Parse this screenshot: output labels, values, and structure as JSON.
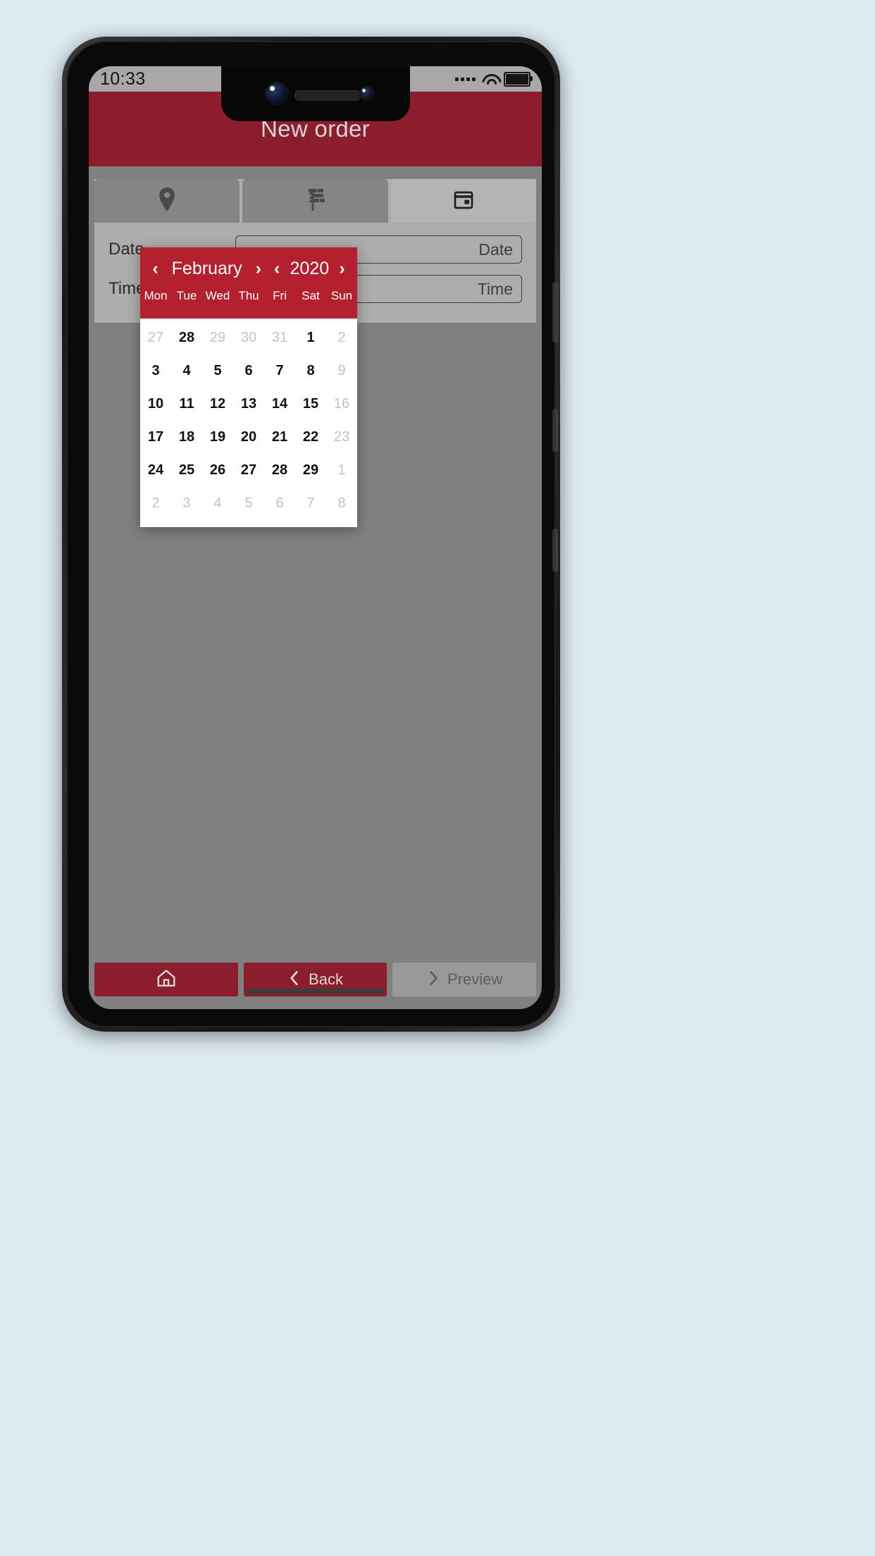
{
  "status_bar": {
    "time": "10:33",
    "icons": [
      "signal-dots-icon",
      "wifi-icon",
      "battery-icon"
    ]
  },
  "app_bar": {
    "title": "New order",
    "background": "#8c1d2c"
  },
  "tabs": [
    {
      "id": "tab-location",
      "icon": "location-pin-icon",
      "active": false
    },
    {
      "id": "tab-signpost",
      "icon": "signpost-icon",
      "active": false
    },
    {
      "id": "tab-schedule",
      "icon": "calendar-icon",
      "active": true
    }
  ],
  "form": {
    "rows": [
      {
        "label": "Date",
        "value": "",
        "placeholder": "Date"
      },
      {
        "label": "Time range",
        "value": "",
        "placeholder": "Time"
      }
    ]
  },
  "date_picker": {
    "accent": "#b5202f",
    "prev_month_label": "‹",
    "next_month_label": "›",
    "prev_year_label": "‹",
    "next_year_label": "›",
    "month": "February",
    "year": "2020",
    "weekdays": [
      "Mon",
      "Tue",
      "Wed",
      "Thu",
      "Fri",
      "Sat",
      "Sun"
    ],
    "weeks": [
      [
        {
          "day": "27",
          "muted": true
        },
        {
          "day": "28",
          "muted": false
        },
        {
          "day": "29",
          "muted": true
        },
        {
          "day": "30",
          "muted": true
        },
        {
          "day": "31",
          "muted": true
        },
        {
          "day": "1",
          "muted": false
        },
        {
          "day": "2",
          "muted": true
        }
      ],
      [
        {
          "day": "3",
          "muted": false
        },
        {
          "day": "4",
          "muted": false
        },
        {
          "day": "5",
          "muted": false
        },
        {
          "day": "6",
          "muted": false
        },
        {
          "day": "7",
          "muted": false
        },
        {
          "day": "8",
          "muted": false
        },
        {
          "day": "9",
          "muted": true
        }
      ],
      [
        {
          "day": "10",
          "muted": false
        },
        {
          "day": "11",
          "muted": false
        },
        {
          "day": "12",
          "muted": false
        },
        {
          "day": "13",
          "muted": false
        },
        {
          "day": "14",
          "muted": false
        },
        {
          "day": "15",
          "muted": false
        },
        {
          "day": "16",
          "muted": true
        }
      ],
      [
        {
          "day": "17",
          "muted": false
        },
        {
          "day": "18",
          "muted": false
        },
        {
          "day": "19",
          "muted": false
        },
        {
          "day": "20",
          "muted": false
        },
        {
          "day": "21",
          "muted": false
        },
        {
          "day": "22",
          "muted": false
        },
        {
          "day": "23",
          "muted": true
        }
      ],
      [
        {
          "day": "24",
          "muted": false
        },
        {
          "day": "25",
          "muted": false
        },
        {
          "day": "26",
          "muted": false
        },
        {
          "day": "27",
          "muted": false
        },
        {
          "day": "28",
          "muted": false
        },
        {
          "day": "29",
          "muted": false
        },
        {
          "day": "1",
          "muted": true
        }
      ],
      [
        {
          "day": "2",
          "muted": true
        },
        {
          "day": "3",
          "muted": true
        },
        {
          "day": "4",
          "muted": true
        },
        {
          "day": "5",
          "muted": true
        },
        {
          "day": "6",
          "muted": true
        },
        {
          "day": "7",
          "muted": true
        },
        {
          "day": "8",
          "muted": true
        }
      ]
    ]
  },
  "bottom_bar": {
    "buttons": [
      {
        "id": "home",
        "label": "",
        "icon": "home-icon",
        "state": "enabled"
      },
      {
        "id": "back",
        "label": "Back",
        "icon": "chevron-left-icon",
        "state": "enabled"
      },
      {
        "id": "preview",
        "label": "Preview",
        "icon": "chevron-right-icon",
        "state": "disabled"
      }
    ]
  }
}
